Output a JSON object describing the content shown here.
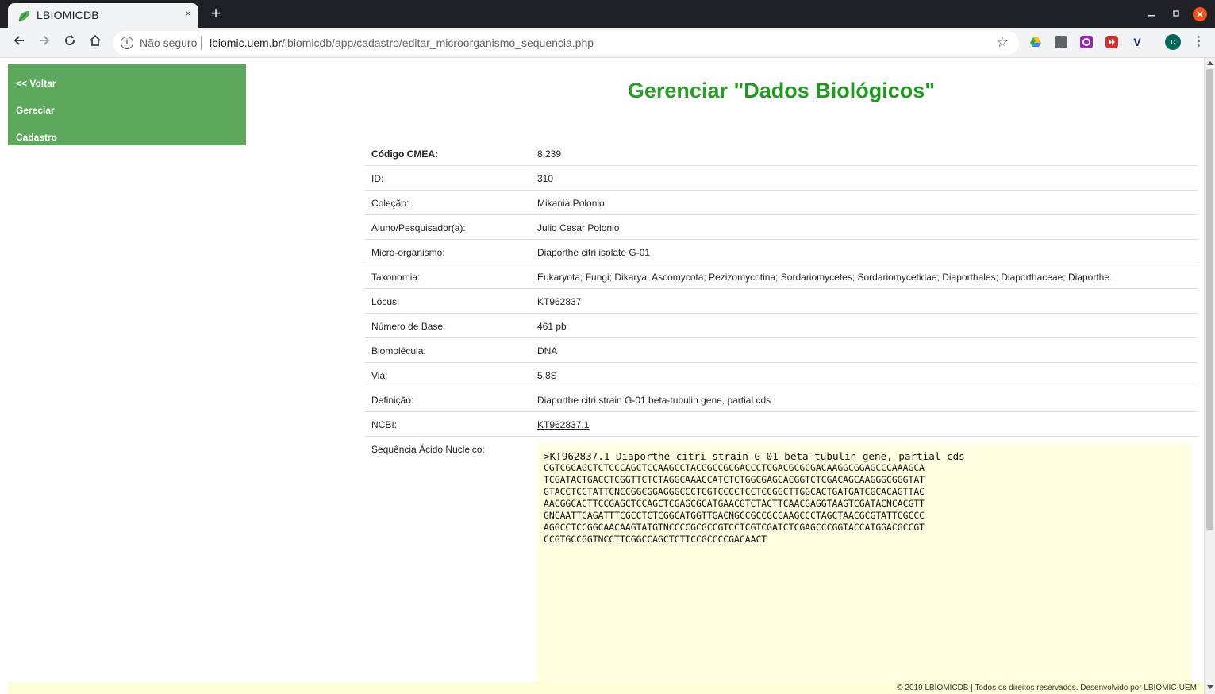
{
  "browser": {
    "tab_title": "LBIOMICDB",
    "tab_close": "×",
    "new_tab": "+",
    "security_label": "Não seguro",
    "url_host": "lbiomic.uem.br",
    "url_path": "/lbiomicdb/app/cadastro/editar_microorganismo_sequencia.php",
    "avatar_initial": "c"
  },
  "sidebar": {
    "items": [
      {
        "label": "<< Voltar"
      },
      {
        "label": "Gereciar"
      },
      {
        "label": "Cadastro"
      }
    ]
  },
  "header": {
    "title_prefix": "Gerenciar ",
    "title_emphasis": "\"Dados Biológicos\""
  },
  "details": {
    "rows": [
      {
        "label": "Código CMEA:",
        "value": "8.239"
      },
      {
        "label": "ID:",
        "value": "310"
      },
      {
        "label": "Coleção:",
        "value": "Mikania.Polonio"
      },
      {
        "label": "Aluno/Pesquisador(a):",
        "value": "Julio Cesar Polonio"
      },
      {
        "label": "Micro-organismo:",
        "value": "Diaporthe citri isolate G-01"
      },
      {
        "label": "Taxonomia:",
        "value": "Eukaryota; Fungi; Dikarya; Ascomycota; Pezizomycotina; Sordariomycetes; Sordariomycetidae; Diaporthales; Diaporthaceae; Diaporthe."
      },
      {
        "label": "Lócus:",
        "value": "KT962837"
      },
      {
        "label": "Número de Base:",
        "value": "461 pb"
      },
      {
        "label": "Biomolécula:",
        "value": "DNA"
      },
      {
        "label": "Via:",
        "value": "5.8S"
      },
      {
        "label": "Definição:",
        "value": "Diaporthe citri strain G-01 beta-tubulin gene, partial cds"
      },
      {
        "label": "NCBI:",
        "value": "KT962837.1"
      }
    ],
    "sequence_label": "Sequência Ácido Nucleico:",
    "sequence_lines": [
      ">KT962837.1 Diaporthe citri strain G-01 beta-tubulin gene, partial cds",
      "CGTCGCAGCTCTCCCAGCTCCAAGCCTACGGCCGCGACCCTCGACGCGCGACAAGGCGGAGCCCAAAGCA",
      "TCGATACTGACCTCGGTTCTCTAGGCAAACCATCTCTGGCGAGCACGGTCTCGACAGCAAGGGCGGGTAT",
      "GTACCTCCTATTCNCCGGCGGAGGGCCCTCGTCCCCTCCTCCGGCTTGGCACTGATGATCGCACAGTTAC",
      "AACGGCACTTCCGAGCTCCAGCTCGAGCGCATGAACGTCTACTTCAACGAGGTAAGTCGATACNCACGTT",
      "GNCAATTCAGATTTCGCCTCTCGGCATGGTTGACNGCCGCCGCCAAGCCCTAGCTAACGCGTATTCGCCC",
      "AGGCCTCCGGCAACAAGTATGTNCCCCGCGCCGTCCTCGTCGATCTCGAGCCCGGTACCATGGACGCCGT",
      "CCGTGCCGGTNCCTTCGGCCAGCTCTTCCGCCCCGACAACT"
    ]
  },
  "footer": {
    "text": "© 2019 LBIOMICDB | Todos os direitos reservados. Desenvolvido por LBIOMIC-UEM"
  },
  "colors": {
    "sidebar_bg": "#5da85d",
    "title_green": "#2a9c2a",
    "sequence_bg": "#fdffe0",
    "footer_bg": "#fdffd6",
    "link_visited": "#660099"
  },
  "icons": [
    "leaf-favicon-icon",
    "close-icon",
    "plus-icon",
    "back-arrow-icon",
    "forward-arrow-icon",
    "reload-icon",
    "home-icon",
    "info-icon",
    "star-icon",
    "drive-icon",
    "camera-icon",
    "record-icon",
    "forward-icon",
    "v-icon",
    "menu-dots-icon"
  ]
}
